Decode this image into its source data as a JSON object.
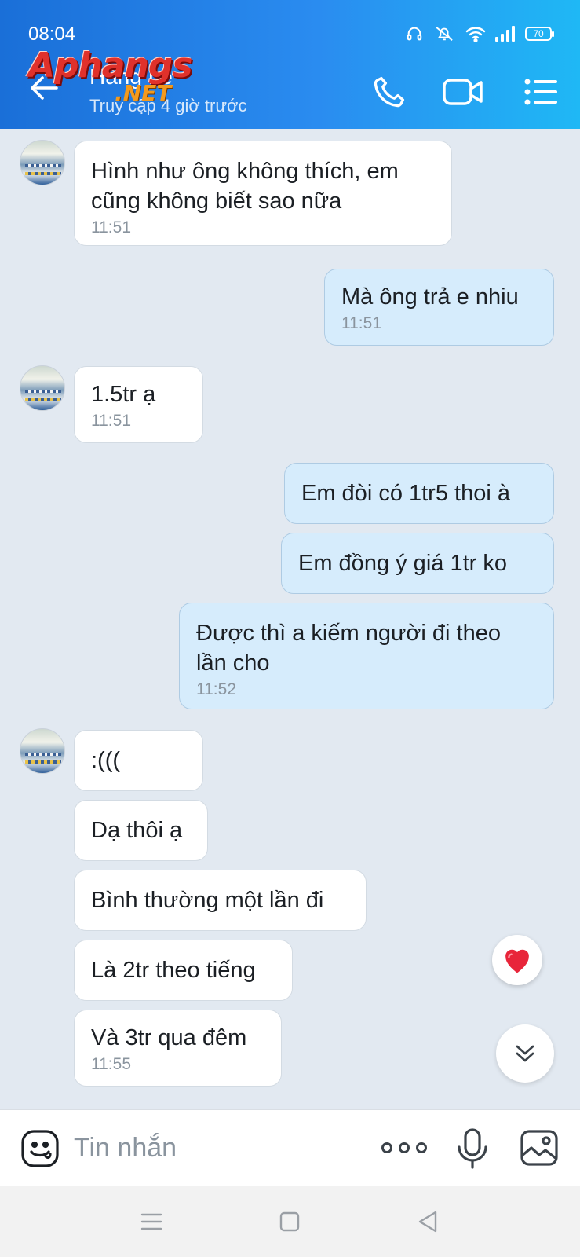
{
  "status_bar": {
    "time": "08:04",
    "battery": "70",
    "icons": [
      "headset-icon",
      "mute-icon",
      "wifi-icon",
      "signal-icon",
      "battery-icon"
    ]
  },
  "header": {
    "contact_name": "Hằng Lê",
    "contact_status": "Truy cập 4 giờ trước",
    "actions": [
      "back-arrow-icon",
      "phone-icon",
      "video-call-icon",
      "menu-list-icon"
    ]
  },
  "watermark": {
    "main": "Aphangs",
    "sub": ".NET"
  },
  "messages": [
    {
      "direction": "in",
      "text": "Hình như ông không thích, em\ncũng không biết sao nữa",
      "time": "11:51"
    },
    {
      "direction": "out",
      "text": "Mà ông trả e nhiu",
      "time": "11:51"
    },
    {
      "direction": "in",
      "text": "1.5tr ạ",
      "time": "11:51"
    },
    {
      "direction": "out",
      "text": "Em đòi có 1tr5 thoi à",
      "time": ""
    },
    {
      "direction": "out",
      "text": "Em đồng ý giá 1tr ko",
      "time": ""
    },
    {
      "direction": "out",
      "text": "Được thì a kiếm người đi theo\nlần cho",
      "time": "11:52"
    },
    {
      "direction": "in",
      "text": ":(((",
      "time": ""
    },
    {
      "direction": "in",
      "text": "Dạ thôi ạ",
      "time": ""
    },
    {
      "direction": "in",
      "text": "Bình thường một lần đi",
      "time": ""
    },
    {
      "direction": "in",
      "text": "Là 2tr theo tiếng",
      "time": ""
    },
    {
      "direction": "in",
      "text": "Và 3tr qua đêm",
      "time": "11:55"
    }
  ],
  "floating": {
    "reaction_icon": "heart-icon",
    "scroll_icon": "double-chevron-down-icon"
  },
  "composer": {
    "placeholder": "Tin nhắn",
    "icons": [
      "emoji-icon",
      "more-options-icon",
      "microphone-icon",
      "image-icon"
    ]
  },
  "nav_bar": {
    "icons": [
      "recent-apps-icon",
      "home-icon",
      "back-icon"
    ]
  },
  "colors": {
    "header_gradient_start": "#1a6fd8",
    "header_gradient_end": "#1fb8f5",
    "chat_background": "#e2e9f1",
    "outgoing_bubble": "#d6ecfc",
    "incoming_bubble": "#ffffff",
    "heart": "#e8253a"
  }
}
